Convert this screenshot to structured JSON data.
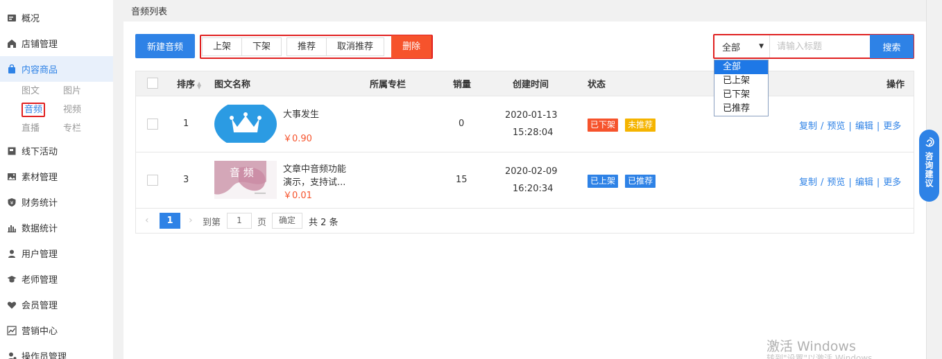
{
  "sidebar": {
    "items": [
      {
        "label": "概况",
        "icon": "list-icon"
      },
      {
        "label": "店铺管理",
        "icon": "home-icon"
      },
      {
        "label": "内容商品",
        "icon": "bag-icon",
        "active": true
      },
      {
        "label": "线下活动",
        "icon": "flag-icon"
      },
      {
        "label": "素材管理",
        "icon": "image-icon"
      },
      {
        "label": "财务统计",
        "icon": "yen-shield-icon"
      },
      {
        "label": "数据统计",
        "icon": "bar-chart-icon"
      },
      {
        "label": "用户管理",
        "icon": "user-icon"
      },
      {
        "label": "老师管理",
        "icon": "graduation-cap-icon"
      },
      {
        "label": "会员管理",
        "icon": "vip-heart-icon"
      },
      {
        "label": "营销中心",
        "icon": "trend-chart-icon"
      },
      {
        "label": "操作员管理",
        "icon": "operator-icon"
      }
    ],
    "sub_items": [
      "图文",
      "图片",
      "音频",
      "视频",
      "直播",
      "专栏"
    ],
    "current_sub": "音频"
  },
  "header": {
    "breadcrumb": "音频列表"
  },
  "toolbar": {
    "new_label": "新建音频",
    "on_shelf": "上架",
    "off_shelf": "下架",
    "recommend": "推荐",
    "unrecommend": "取消推荐",
    "delete": "删除"
  },
  "search": {
    "filter_value": "全部",
    "placeholder": "请输入标题",
    "button": "搜索",
    "options": [
      "全部",
      "已上架",
      "已下架",
      "已推荐"
    ]
  },
  "table": {
    "columns": {
      "sort": "排序",
      "name": "图文名称",
      "column": "所属专栏",
      "sales": "销量",
      "created": "创建时间",
      "status": "状态",
      "actions": "操作"
    },
    "rows": [
      {
        "sort": "1",
        "title": "大事发生",
        "title2": "",
        "price": "￥0.90",
        "column": "",
        "sales": "0",
        "date": "2020-01-13",
        "time": "15:28:04",
        "status1": "已下架",
        "status1_color": "#f6532c",
        "status2": "未推荐",
        "status2_color": "#f5b400",
        "thumb_text": ""
      },
      {
        "sort": "3",
        "title": "文章中音频功能",
        "title2": "演示，支持试...",
        "price": "￥0.01",
        "column": "",
        "sales": "15",
        "date": "2020-02-09",
        "time": "16:20:34",
        "status1": "已上架",
        "status1_color": "#2e82e6",
        "status2": "已推荐",
        "status2_color": "#2e82e6",
        "thumb_text": "音 频"
      }
    ],
    "ops": {
      "copy": "复制",
      "preview": "预览",
      "edit": "编辑",
      "more": "更多",
      "slash": "/",
      "bar": "|"
    }
  },
  "pager": {
    "current": "1",
    "goto_label": "到第",
    "page_input": "1",
    "page_unit": "页",
    "confirm": "确定",
    "total": "共 2 条"
  },
  "feedback": {
    "label": "咨询建议"
  },
  "watermark": {
    "line1": "激活 Windows",
    "line2": "转到\"设置\"以激活 Windows。"
  }
}
